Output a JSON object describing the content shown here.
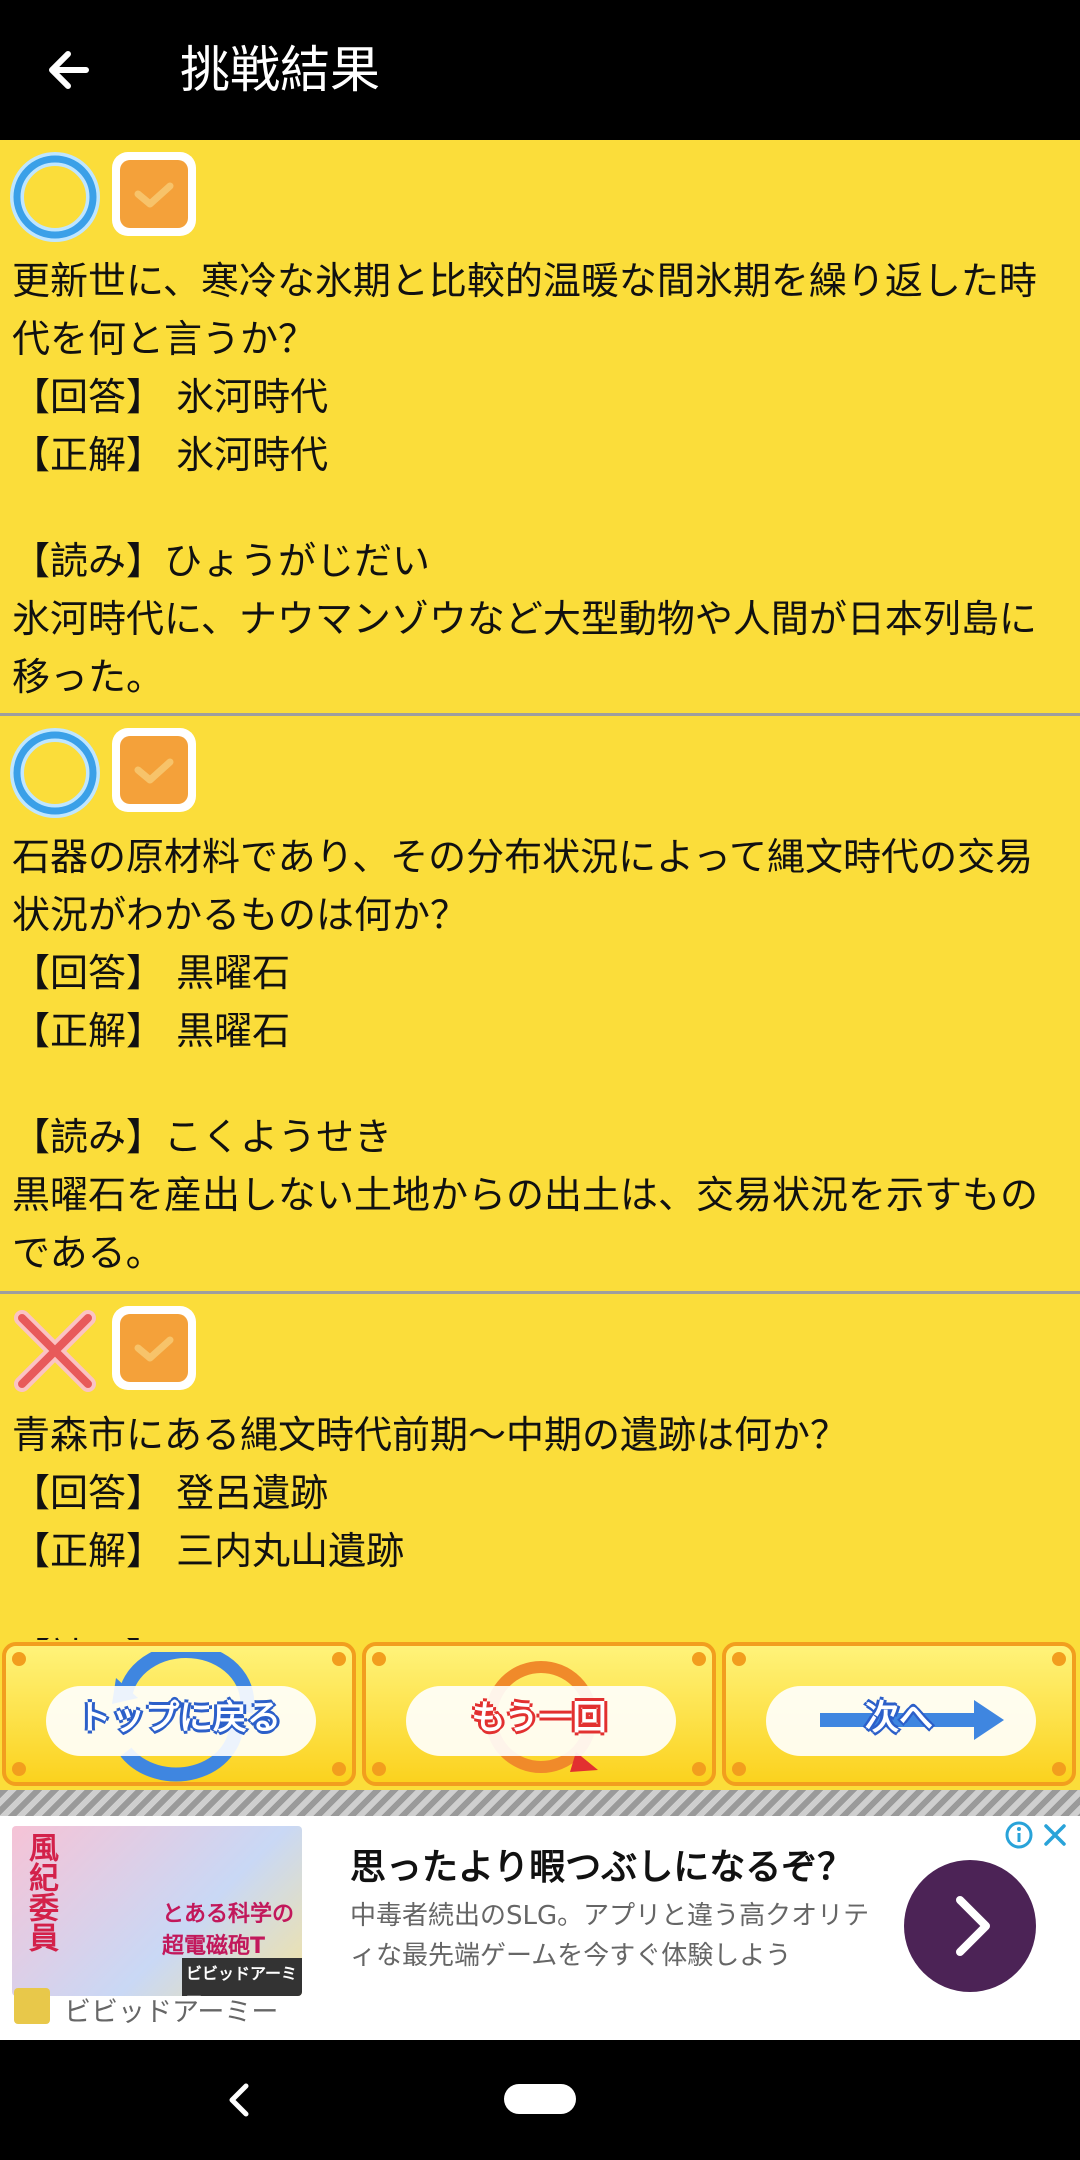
{
  "header": {
    "title": "挑戦結果",
    "back_icon": "arrow-left-icon"
  },
  "colors": {
    "background": "#fbdd3a",
    "header": "#000000",
    "checkbox": "#f4a13a",
    "correct_ring": "#3aa0e8",
    "wrong_mark": "#e85a5a",
    "ad_cta": "#4c2356"
  },
  "results": [
    {
      "status": "correct",
      "status_icon": "circle-correct-icon",
      "question": "更新世に、寒冷な氷期と比較的温暖な間氷期を繰り返した時代を何と言うか？",
      "answer_line": "【回答】 氷河時代",
      "correct_line": "【正解】 氷河時代",
      "reading_line": "【読み】ひょうがじだい",
      "explanation": "氷河時代に、ナウマンゾウなど大型動物や人間が日本列島に移った。"
    },
    {
      "status": "correct",
      "status_icon": "circle-correct-icon",
      "question": "石器の原材料であり、その分布状況によって縄文時代の交易状況がわかるものは何か？",
      "answer_line": "【回答】 黒曜石",
      "correct_line": "【正解】 黒曜石",
      "reading_line": "【読み】こくようせき",
      "explanation": "黒曜石を産出しない土地からの出土は、交易状況を示すものである。"
    },
    {
      "status": "wrong",
      "status_icon": "cross-wrong-icon",
      "question": "青森市にある縄文時代前期〜中期の遺跡は何か？",
      "answer_line": "【回答】 登呂遺跡",
      "correct_line": "【正解】 三内丸山遺跡",
      "reading_line": "【読み】",
      "explanation": ""
    }
  ],
  "buttons": {
    "top": "トップに戻る",
    "retry": "もう一回",
    "next": "次へ"
  },
  "ad": {
    "image_text_1": "風紀委員",
    "image_text_2": "とある科学の超電磁砲T",
    "image_text_3": "ビビッドアーミー",
    "brand": "ビビッドアーミー",
    "title": "思ったより暇つぶしになるぞ？",
    "description": "中毒者続出のSLG。アプリと違う高クオリティな最先端ゲームを今すぐ体験しよう"
  }
}
